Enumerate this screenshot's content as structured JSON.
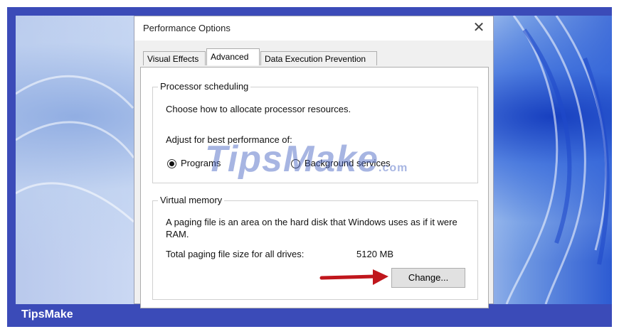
{
  "dialog": {
    "title": "Performance Options",
    "close_glyph": "✕"
  },
  "tabs": [
    {
      "label": "Visual Effects",
      "active": false
    },
    {
      "label": "Advanced",
      "active": true
    },
    {
      "label": "Data Execution Prevention",
      "active": false
    }
  ],
  "processor": {
    "legend": "Processor scheduling",
    "description": "Choose how to allocate processor resources.",
    "adjust_label": "Adjust for best performance of:",
    "options": [
      {
        "label": "Programs",
        "checked": true
      },
      {
        "label": "Background services",
        "checked": false
      }
    ]
  },
  "virtual_memory": {
    "legend": "Virtual memory",
    "description": "A paging file is an area on the hard disk that Windows uses as if it were RAM.",
    "total_label": "Total paging file size for all drives:",
    "total_value": "5120 MB",
    "change_button": "Change..."
  },
  "watermark": {
    "main": "TipsMake",
    "suffix": ".com"
  },
  "footer": {
    "brand": "TipsMake"
  },
  "colors": {
    "frame": "#3b4bb8",
    "arrow": "#c0161c"
  }
}
